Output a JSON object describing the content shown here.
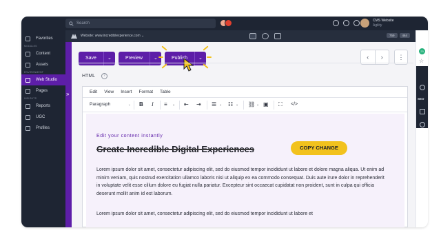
{
  "topbar": {
    "search_placeholder": "Search",
    "account_name": "CMS Website",
    "account_sub": "Agility"
  },
  "nav": {
    "items": [
      {
        "label": "Favorites",
        "icon": "star-icon",
        "section": ""
      },
      {
        "label": "Content",
        "icon": "content-icon",
        "section": "MODULES"
      },
      {
        "label": "Assets",
        "icon": "assets-icon",
        "section": ""
      },
      {
        "label": "Web Studio",
        "icon": "web-studio-icon",
        "section": "ENVIRONMENT",
        "active": true
      },
      {
        "label": "Pages",
        "icon": "pages-icon",
        "section": ""
      },
      {
        "label": "Reports",
        "icon": "reports-icon",
        "section": "INSIGHTS"
      },
      {
        "label": "UGC",
        "icon": "ugc-icon",
        "section": ""
      },
      {
        "label": "Profiles",
        "icon": "profiles-icon",
        "section": ""
      }
    ]
  },
  "subbar": {
    "website_label": "Website: www.incrediblexperience.com",
    "zoom_width": "759",
    "zoom_height": "464"
  },
  "toolbar": {
    "save_label": "Save",
    "preview_label": "Preview",
    "publish_label": "Publish",
    "accent": "#5d1ea8",
    "highlight": "#f2c21d"
  },
  "field": {
    "label": "HTML"
  },
  "editor": {
    "menu": [
      "Edit",
      "View",
      "Insert",
      "Format",
      "Table"
    ],
    "block_format": "Paragraph"
  },
  "content": {
    "eyebrow": "Edit your content instantly",
    "headline": "Create Incredible Digital Experiences",
    "copy_button": "COPY CHANGE",
    "paragraph1": "Lorem ipsum dolor sit amet, consectetur adipiscing elit, sed do eiusmod tempor incididunt ut labore et dolore magna aliqua. Ut enim ad minim veniam, quis nostrud exercitation ullamco laboris nisi ut aliquip ex ea commodo consequat. Duis aute irure dolor in reprehenderit in voluptate velit esse cillum dolore eu fugiat nulla pariatur. Excepteur sint occaecat cupidatat non proident, sunt in culpa qui officia deserunt mollit anim id est laborum.",
    "paragraph2": "Lorem ipsum dolor sit amet, consectetur adipiscing elit, sed do eiusmod tempor incididunt ut labore et"
  },
  "rail": {
    "badge": "23",
    "seo_label": "SEO"
  }
}
